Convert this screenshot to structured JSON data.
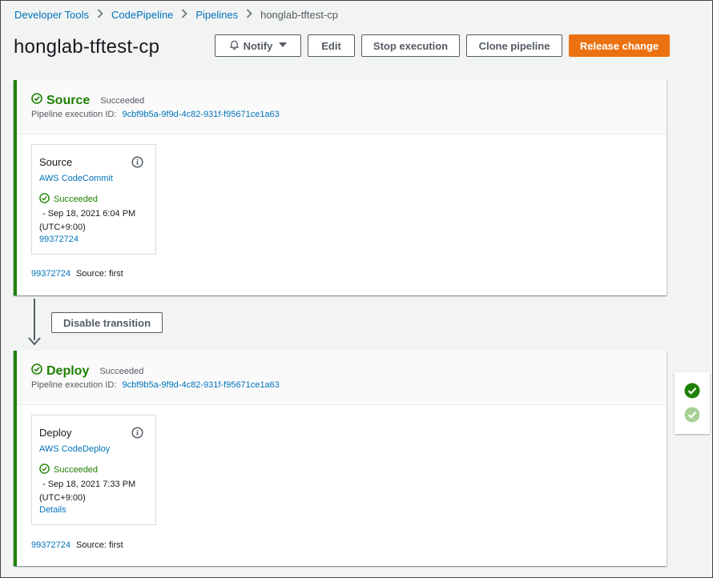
{
  "breadcrumb": {
    "items": [
      "Developer Tools",
      "CodePipeline",
      "Pipelines"
    ],
    "current": "honglab-tftest-cp"
  },
  "header": {
    "title": "honglab-tftest-cp",
    "notify_label": "Notify",
    "edit_label": "Edit",
    "stop_label": "Stop execution",
    "clone_label": "Clone pipeline",
    "release_label": "Release change"
  },
  "colors": {
    "success": "#1d8102",
    "accent": "#ec7211",
    "link": "#0073bb"
  },
  "stages": [
    {
      "name": "Source",
      "status": "Succeeded",
      "exec_label": "Pipeline execution ID:",
      "exec_id": "9cbf9b5a-9f9d-4c82-931f-f95671ce1a63",
      "action": {
        "title": "Source",
        "provider": "AWS CodeCommit",
        "status": "Succeeded",
        "time_line1": "- Sep 18, 2021 6:04 PM",
        "time_line2": "(UTC+9:00)",
        "extra": "99372724"
      },
      "footer_link": "99372724",
      "footer_text": "Source: first"
    },
    {
      "name": "Deploy",
      "status": "Succeeded",
      "exec_label": "Pipeline execution ID:",
      "exec_id": "9cbf9b5a-9f9d-4c82-931f-f95671ce1a63",
      "action": {
        "title": "Deploy",
        "provider": "AWS CodeDeploy",
        "status": "Succeeded",
        "time_line1": "- Sep 18, 2021 7:33 PM",
        "time_line2": "(UTC+9:00)",
        "extra": "Details"
      },
      "footer_link": "99372724",
      "footer_text": "Source: first"
    }
  ],
  "transition": {
    "button_label": "Disable transition"
  }
}
